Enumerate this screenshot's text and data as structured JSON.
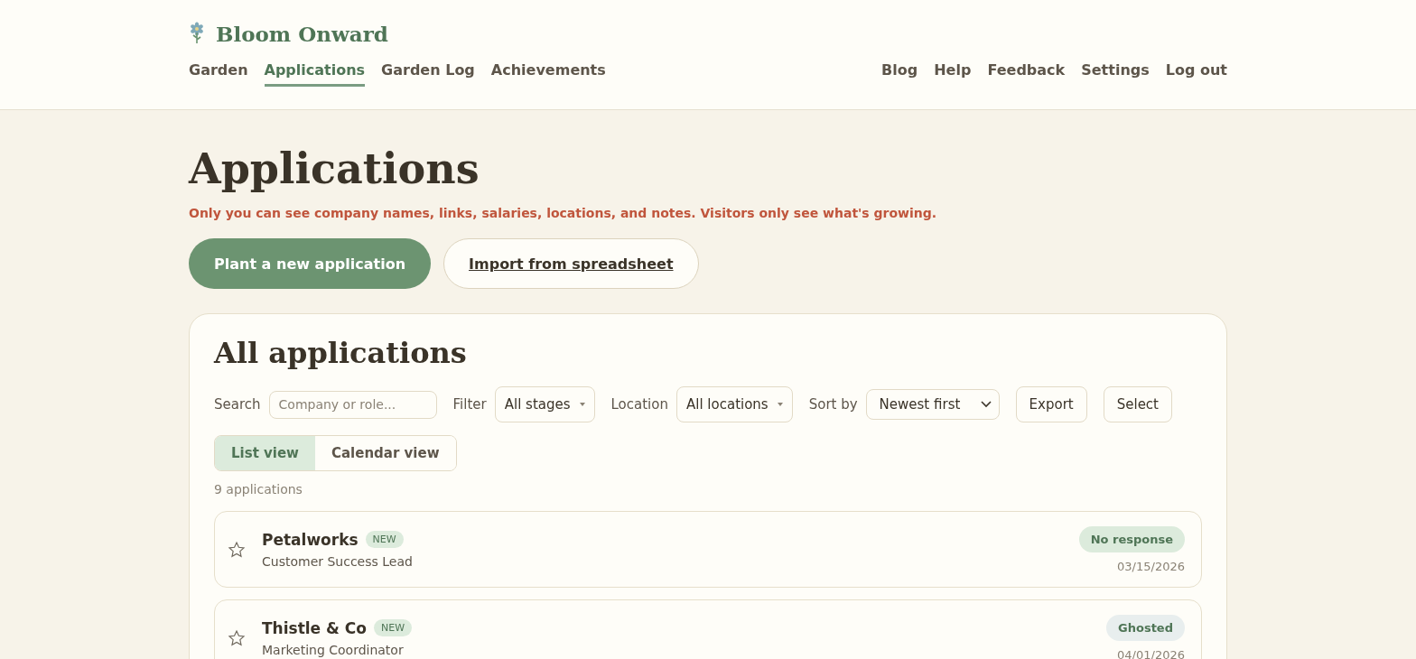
{
  "brand": {
    "name": "Bloom Onward"
  },
  "nav": {
    "main": [
      {
        "label": "Garden",
        "selected": false
      },
      {
        "label": "Applications",
        "selected": true
      },
      {
        "label": "Garden Log",
        "selected": false
      },
      {
        "label": "Achievements",
        "selected": false
      }
    ],
    "secondary": [
      {
        "label": "Blog"
      },
      {
        "label": "Help"
      },
      {
        "label": "Feedback"
      },
      {
        "label": "Settings"
      },
      {
        "label": "Log out"
      }
    ]
  },
  "page": {
    "title": "Applications",
    "privacy_note": "Only you can see company names, links, salaries, locations, and notes. Visitors only see what's growing.",
    "primary_action": "Plant a new application",
    "secondary_action": "Import from spreadsheet"
  },
  "panel": {
    "title": "All applications",
    "filters": [
      {
        "kind": "search",
        "label": "Search",
        "placeholder": "Company or role..."
      },
      {
        "kind": "dropdown",
        "label": "Filter",
        "value": "All stages"
      },
      {
        "kind": "dropdown",
        "label": "Location",
        "value": "All locations"
      },
      {
        "kind": "select",
        "label": "Sort by",
        "value": "Newest first"
      }
    ],
    "actions": [
      "Export",
      "Select"
    ],
    "views": [
      {
        "label": "List view",
        "selected": true
      },
      {
        "label": "Calendar view",
        "selected": false
      }
    ],
    "count": "9 applications",
    "applications": [
      {
        "company": "Petalworks",
        "badge": "NEW",
        "role": "Customer Success Lead",
        "status": "No response",
        "color": "#dcebdc",
        "date": "03/15/2026",
        "starred": false
      },
      {
        "company": "Thistle & Co",
        "badge": "NEW",
        "role": "Marketing Coordinator",
        "status": "Ghosted",
        "color": "#e8eeee",
        "date": "04/01/2026",
        "starred": false
      }
    ]
  }
}
